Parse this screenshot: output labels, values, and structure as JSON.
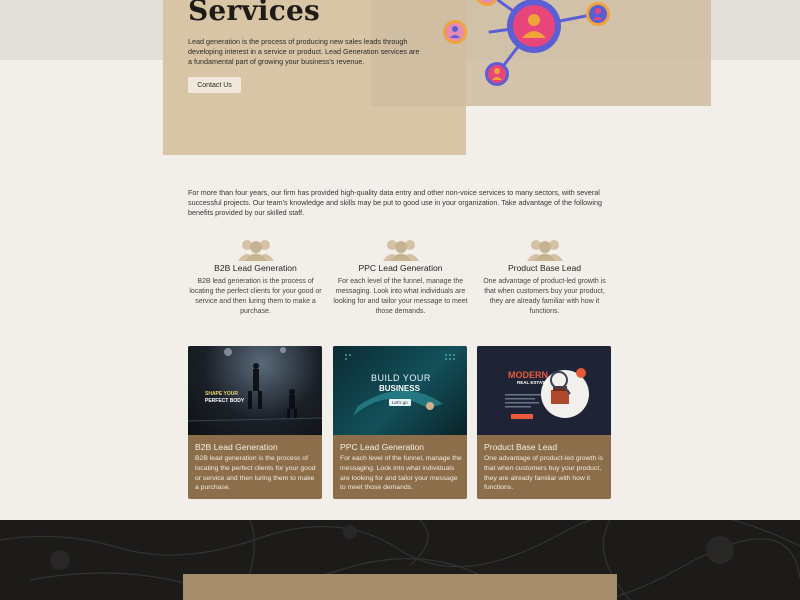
{
  "hero": {
    "title": "Services",
    "description": "Lead generation is the process of producing new sales leads through developing interest in a service or product. Lead Generation services are a fundamental part of growing your business's revenue.",
    "cta_label": "Contact Us"
  },
  "intro": {
    "text": "For more than four years, our firm has provided high-quality data entry and other non-voice services to many sectors, with several successful projects. Our team's knowledge and skills may be put to good use in your organization. Take advantage of the following benefits provided by our skilled staff."
  },
  "features": [
    {
      "icon": "users-group-icon",
      "title": "B2B Lead Generation",
      "text": "B2B lead generation is the process of locating the perfect clients for your good or service and then luring them to make a purchase."
    },
    {
      "icon": "users-group-icon",
      "title": "PPC Lead Generation",
      "text": "For each level of the funnel, manage the messaging. Look into what individuals are looking for and tailor your message to meet those demands."
    },
    {
      "icon": "users-group-icon",
      "title": "Product Base Lead",
      "text": "One advantage of product-led growth is that when customers buy your product, they are already familiar with how it functions."
    }
  ],
  "cards": [
    {
      "image_caption_1": "SHAPE YOUR",
      "image_caption_2": "PERFECT BODY",
      "title": "B2B Lead Generation",
      "text": "B2B lead generation is the process of locating the perfect clients for your good or service and then luring them to make a purchase."
    },
    {
      "image_caption_1": "BUILD YOUR",
      "image_caption_2": "BUSINESS",
      "image_badge": "Let's go",
      "title": "PPC Lead Generation",
      "text": "For each level of the funnel, manage the messaging. Look into what individuals are looking for and tailor your message to meet those demands."
    },
    {
      "image_caption_1": "MODERN",
      "image_caption_2": "REAL ESTATE",
      "title": "Product Base Lead",
      "text": "One advantage of product-led growth is that when customers buy your product, they are already familiar with how it functions."
    }
  ],
  "colors": {
    "page_bg": "#f2efeb",
    "hero_tan": "#d8c5a5",
    "card_brown": "#8d6e4a",
    "dark_section": "#1c1b1a",
    "network_blue": "#5b5fd6",
    "network_orange": "#f0a33a"
  }
}
